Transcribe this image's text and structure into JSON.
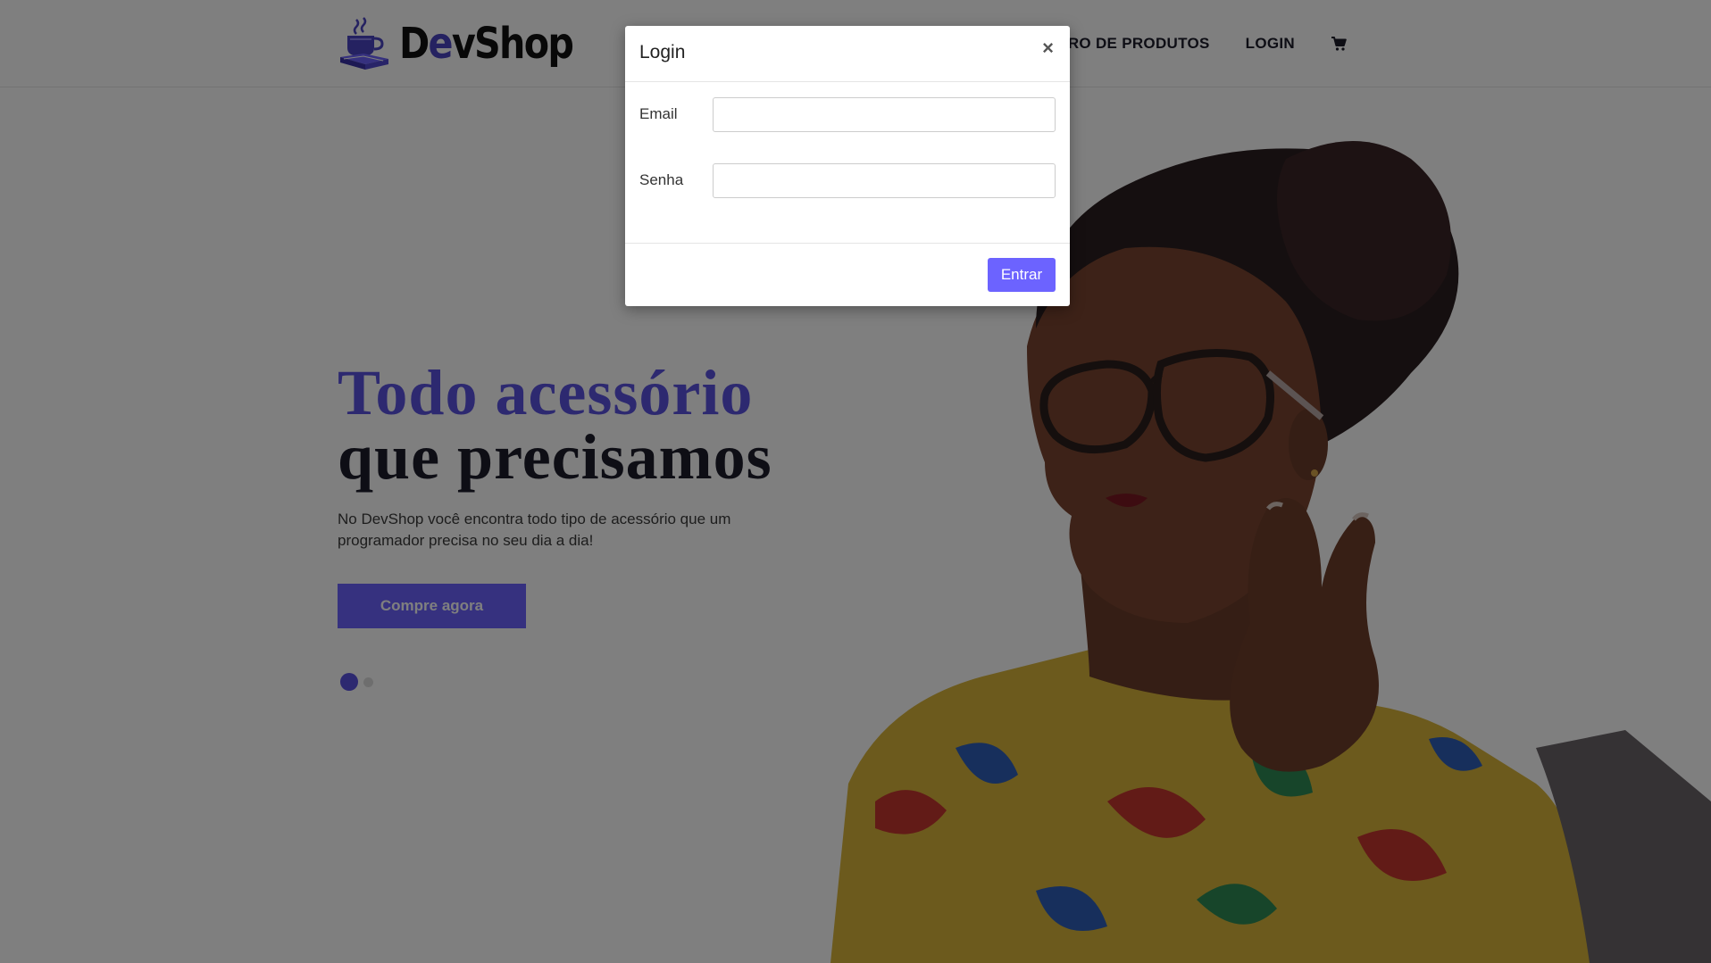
{
  "navbar": {
    "brand_prefix": "D",
    "brand_accent": "e",
    "brand_suffix": "vShop",
    "links": [
      {
        "label": "Cadastro de Produtos"
      },
      {
        "label": "Login"
      }
    ],
    "cart_icon": "cart-icon"
  },
  "hero": {
    "title_line1": "Todo acessório",
    "title_line2": "que precisamos",
    "description": "No DevShop você encontra todo tipo de acessório que um programador precisa no seu dia a dia!",
    "cta_label": "Compre agora",
    "carousel": {
      "slides": 2,
      "active_index": 0
    }
  },
  "modal": {
    "title": "Login",
    "close_label": "×",
    "email_label": "Email",
    "email_value": "",
    "senha_label": "Senha",
    "senha_value": "",
    "submit_label": "Entrar"
  },
  "colors": {
    "accent": "#6c63ff",
    "brand_dark": "#4b44c2",
    "text_dark": "#1c1c2b",
    "backdrop": "rgba(0,0,0,0.5)"
  }
}
